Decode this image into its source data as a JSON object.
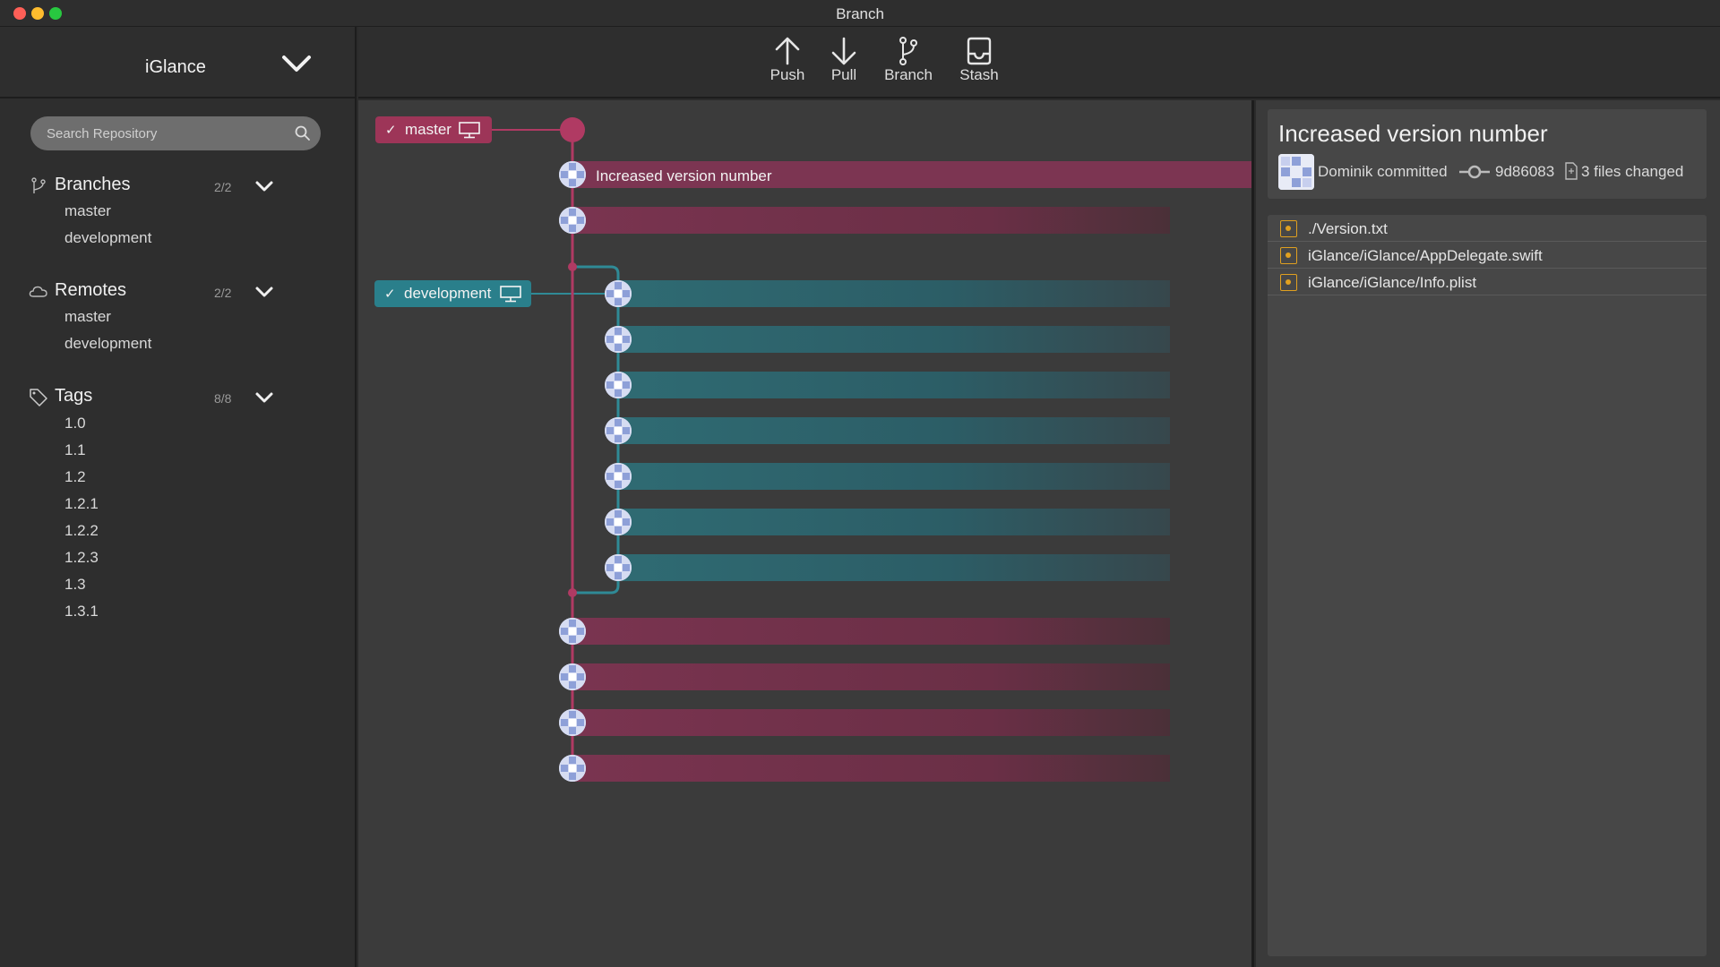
{
  "window": {
    "title": "Branch"
  },
  "repo": {
    "name": "iGlance"
  },
  "search": {
    "placeholder": "Search Repository"
  },
  "sidebar": {
    "branches": {
      "title": "Branches",
      "count": "2/2",
      "items": [
        "master",
        "development"
      ]
    },
    "remotes": {
      "title": "Remotes",
      "count": "2/2",
      "items": [
        "master",
        "development"
      ]
    },
    "tags": {
      "title": "Tags",
      "count": "8/8",
      "items": [
        "1.0",
        "1.1",
        "1.2",
        "1.2.1",
        "1.2.2",
        "1.2.3",
        "1.3",
        "1.3.1"
      ]
    }
  },
  "toolbar": {
    "push": "Push",
    "pull": "Pull",
    "branch": "Branch",
    "stash": "Stash"
  },
  "graph": {
    "master_tag": "master",
    "development_tag": "development",
    "selected_commit_message": "Increased version number",
    "colors": {
      "master": "#b03a63",
      "development": "#2f8a96"
    }
  },
  "commit": {
    "title": "Increased version number",
    "author": "Dominik committed",
    "hash": "9d86083",
    "files_changed": "3 files changed",
    "files": [
      "./Version.txt",
      "iGlance/iGlance/AppDelegate.swift",
      "iGlance/iGlance/Info.plist"
    ]
  }
}
